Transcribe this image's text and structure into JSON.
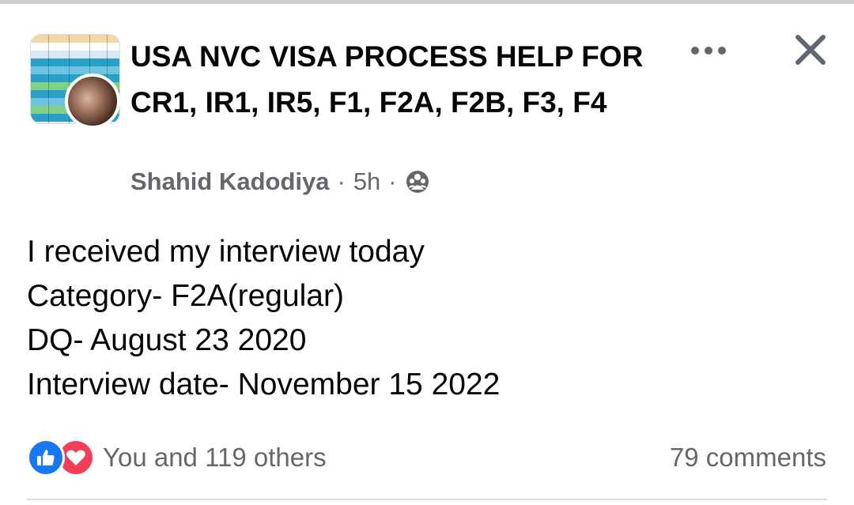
{
  "post": {
    "group_title": "USA NVC VISA PROCESS HELP FOR CR1, IR1, IR5, F1, F2A, F2B, F3, F4",
    "author": "Shahid Kadodiya",
    "separator": "·",
    "time": "5h",
    "audience_icon": "group-audience-icon",
    "more_icon": "more-options-icon",
    "close_icon": "close-icon",
    "body_lines": [
      "I received my interview today",
      "Category- F2A(regular)",
      "DQ- August 23 2020",
      "Interview date- November 15 2022"
    ],
    "reactions": {
      "icons": [
        "like-icon",
        "love-icon"
      ],
      "text": "You and 119 others"
    },
    "comments": "79 comments"
  },
  "colors": {
    "text_primary": "#050505",
    "text_secondary": "#65676b",
    "like_blue": "#1877f2",
    "love_red": "#f33e58",
    "icon_gray": "#606770"
  }
}
